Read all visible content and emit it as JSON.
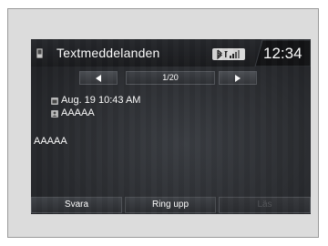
{
  "header": {
    "title": "Textmeddelanden",
    "time": "12:34",
    "phone_icon": "phone-icon",
    "status_icons": [
      "bluetooth-icon",
      "signal-strength-icon"
    ]
  },
  "navigation": {
    "prev_icon": "arrow-left-icon",
    "next_icon": "arrow-right-icon",
    "page_indicator": "1/20"
  },
  "message": {
    "date": "Aug. 19 10:43 AM",
    "sender": "AAAAA",
    "body": "AAAAA",
    "date_icon": "calendar-icon",
    "sender_icon": "contact-icon"
  },
  "softkeys": {
    "reply": "Svara",
    "call": "Ring upp",
    "read": "Läs"
  }
}
